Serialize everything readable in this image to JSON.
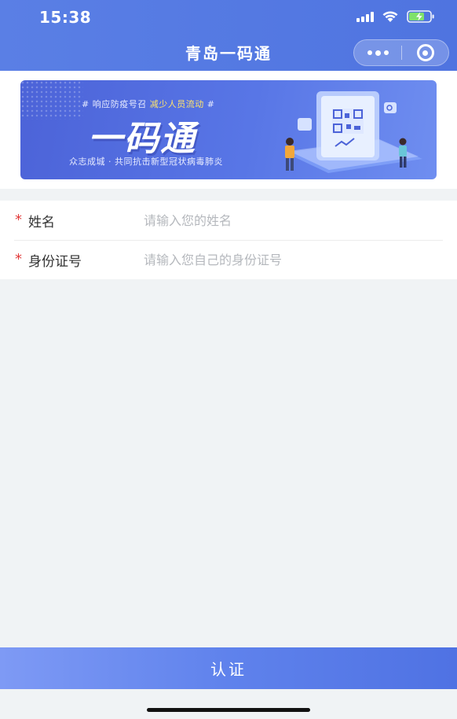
{
  "status_bar": {
    "time": "15:38"
  },
  "nav": {
    "title": "青岛一码通"
  },
  "banner": {
    "hashtag_prefix": "# 响应防疫号召 ",
    "hashtag_highlight": "减少人员流动",
    "hashtag_suffix": " #",
    "headline": "一码通",
    "subline": "众志成城 · 共同抗击新型冠状病毒肺炎"
  },
  "form": {
    "fields": [
      {
        "required_mark": "*",
        "label": "姓名",
        "placeholder": "请输入您的姓名",
        "value": ""
      },
      {
        "required_mark": "*",
        "label": "身份证号",
        "placeholder": "请输入您自己的身份证号",
        "value": ""
      }
    ]
  },
  "actions": {
    "submit_label": "认证"
  },
  "colors": {
    "primary": "#4f74e0",
    "required": "#e23b3b",
    "background": "#f0f3f5"
  }
}
